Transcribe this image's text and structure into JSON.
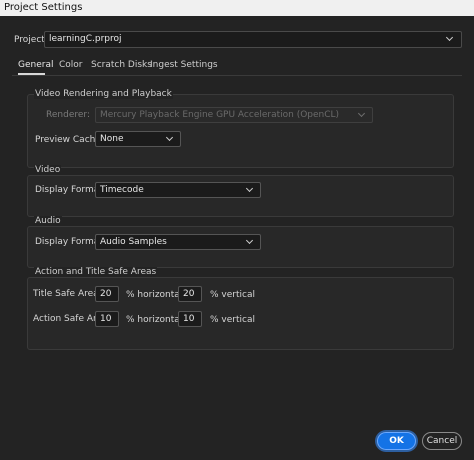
{
  "window": {
    "title": "Project Settings"
  },
  "project": {
    "label": "Project:",
    "value": "learningC.prproj"
  },
  "tabs": [
    {
      "label": "General",
      "active": true
    },
    {
      "label": "Color",
      "active": false
    },
    {
      "label": "Scratch Disks",
      "active": false
    },
    {
      "label": "Ingest Settings",
      "active": false
    }
  ],
  "video_rendering": {
    "title": "Video Rendering and Playback",
    "renderer_label": "Renderer:",
    "renderer_value": "Mercury Playback Engine GPU Acceleration (OpenCL)",
    "preview_cache_label": "Preview Cache:",
    "preview_cache_value": "None"
  },
  "video": {
    "title": "Video",
    "display_format_label": "Display Format:",
    "display_format_value": "Timecode"
  },
  "audio": {
    "title": "Audio",
    "display_format_label": "Display Format:",
    "display_format_value": "Audio Samples"
  },
  "safe_areas": {
    "title": "Action and Title Safe Areas",
    "title_safe_label": "Title Safe Area",
    "title_safe_h": "20",
    "title_safe_v": "20",
    "action_safe_label": "Action Safe Area",
    "action_safe_h": "10",
    "action_safe_v": "10",
    "horizontal_unit": "% horizontal",
    "vertical_unit": "% vertical"
  },
  "buttons": {
    "ok": "OK",
    "cancel": "Cancel"
  },
  "colors": {
    "accent": "#1473e6",
    "background": "#232323"
  }
}
